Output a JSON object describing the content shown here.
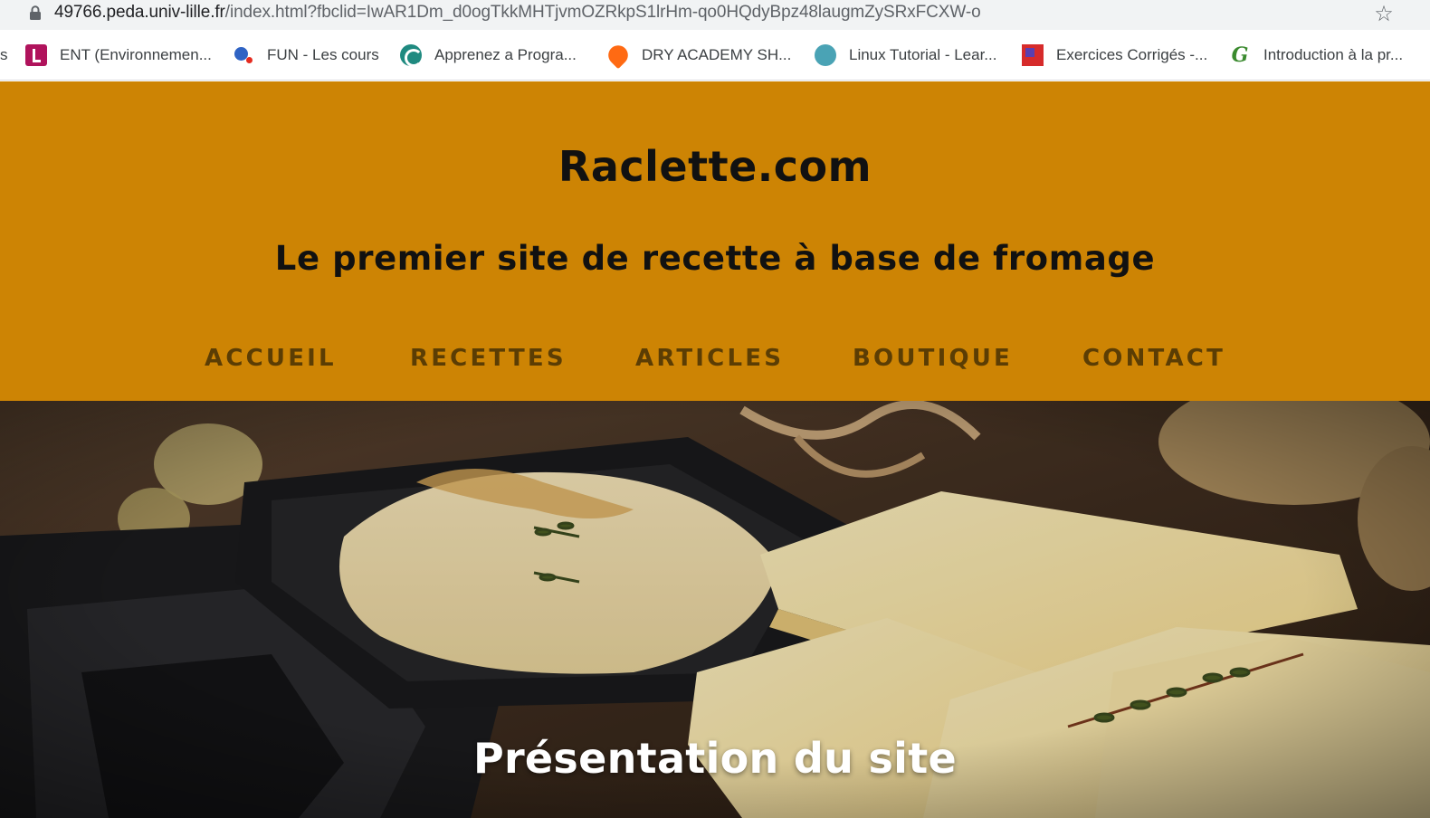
{
  "browser": {
    "url_host": "49766.peda.univ-lille.fr",
    "url_path": "/index.html?fbclid=IwAR1Dm_d0ogTkkMHTjvmOZRkpS1lrHm-qo0HQdyBpz48laugmZySRxFCXW-o",
    "bookmark_edge_text": "s",
    "bookmarks": [
      {
        "label": "ENT (Environnemen...",
        "icon": "ent-favicon"
      },
      {
        "label": "FUN - Les cours",
        "icon": "fun-favicon"
      },
      {
        "label": "Apprenez a Progra...",
        "icon": "openclassrooms-favicon"
      },
      {
        "label": "DRY ACADEMY SH...",
        "icon": "dry-academy-favicon"
      },
      {
        "label": "Linux Tutorial - Lear...",
        "icon": "linux-favicon"
      },
      {
        "label": "Exercices Corrigés -...",
        "icon": "exercices-favicon"
      },
      {
        "label": "Introduction à la pr...",
        "icon": "g-favicon"
      }
    ]
  },
  "site": {
    "title": "Raclette.com",
    "tagline": "Le premier site de recette à base de fromage",
    "nav": [
      "ACCUEIL",
      "RECETTES",
      "ARTICLES",
      "BOUTIQUE",
      "CONTACT"
    ],
    "hero_title": "Présentation du site"
  },
  "colors": {
    "header_background": "#cd8404",
    "nav_text": "#5b3d04",
    "title_text": "#111111",
    "hero_title_text": "#ffffff"
  }
}
